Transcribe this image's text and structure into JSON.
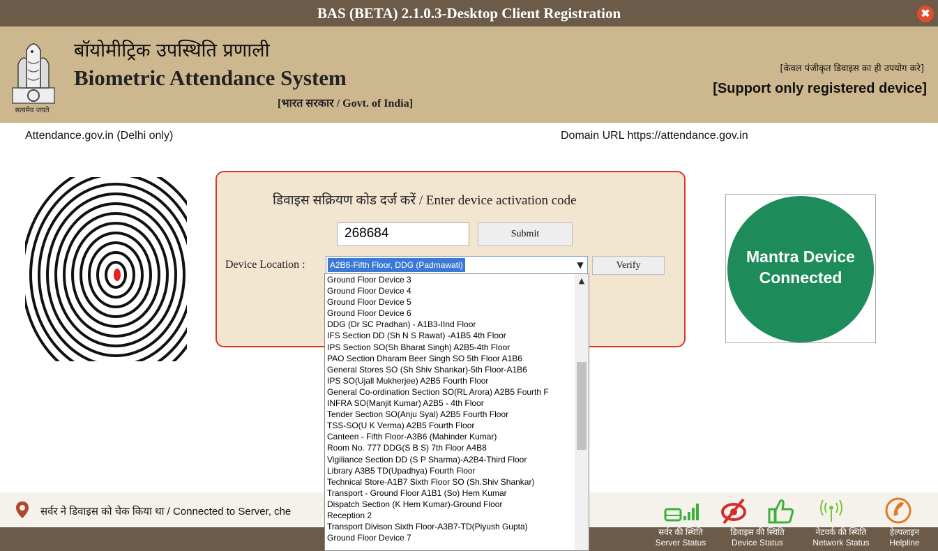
{
  "window": {
    "title": "BAS (BETA) 2.1.0.3-Desktop Client Registration",
    "close_glyph": "✖"
  },
  "header": {
    "emblem_caption": "सत्यमेव जयते",
    "hindi_title": "बॉयोमीट्रिक उपस्थिति प्रणाली",
    "english_title": "Biometric Attendance System",
    "govt_label": "[भारत सरकार / Govt. of India]",
    "support_hindi": "[केवल पंजीकृत डिवाइस का ही उपयोग करे]",
    "support_english": "[Support only registered device]"
  },
  "subheader": {
    "left": "Attendance.gov.in (Delhi only)",
    "right": "Domain URL https://attendance.gov.in"
  },
  "activation": {
    "title": "डिवाइस सक्रियण कोड दर्ज करें / Enter device activation code",
    "code_value": "268684",
    "submit_label": "Submit",
    "location_label": "Device Location :",
    "location_selected": "A2B6-Fifth Floor, DDG (Padmawati)",
    "verify_label": "Verify"
  },
  "device_status_badge": {
    "line1": "Mantra Device",
    "line2": "Connected",
    "color": "#1e8c5a"
  },
  "dropdown": {
    "options": [
      "Ground Floor Device 3",
      "Ground Floor Device 4",
      "Ground Floor Device 5",
      "Ground Floor Device 6",
      "DDG (Dr SC Pradhan) - A1B3-IInd Floor",
      "IFS Section DD (Sh N S Rawat) -A1B5 4th Floor",
      "IPS Section SO(Sh Bharat Singh) A2B5-4th Floor",
      "PAO Section Dharam Beer Singh SO 5th Floor A1B6",
      "General Stores SO (Sh Shiv Shankar)-5th Floor-A1B6",
      "IPS SO(Ujall Mukherjee) A2B5 Fourth Floor",
      "General Co-ordination Section SO(RL Arora) A2B5 Fourth F",
      "INFRA SO(Manjit Kumar) A2B5 - 4th Floor",
      "Tender Section SO(Anju Syal) A2B5 Fourth Floor",
      "TSS-SO(U K Verma) A2B5 Fourth Floor",
      "Canteen - Fifth Floor-A3B6 (Mahinder Kumar)",
      "Room No. 777 DDG(S B S) 7th Floor A4B8",
      "Vigiliance Section DD (S P Sharma)-A2B4-Third Floor",
      "Library A3B5 TD(Upadhya) Fourth Floor",
      "Technical Store-A1B7 Sixth Floor SO (Sh.Shiv Shankar)",
      "Transport - Ground Floor A1B1 (So) Hem Kumar",
      "Dispatch Section (K Hem Kumar)-Ground Floor",
      "Reception 2",
      "Transport Divison Sixth Floor-A3B7-TD(Piyush Gupta)",
      "Ground Floor Device 7"
    ]
  },
  "status": {
    "text": "सर्वर ने डिवाइस को चेक किया था / Connected to Server, che",
    "pin_icon": "location-pin-icon"
  },
  "footer_icons": [
    {
      "hindi": "सर्वर की स्थिति",
      "english": "Server Status",
      "icon": "server-signal-icon"
    },
    {
      "hindi": "डिवाइस की स्थिति",
      "english": "Device Status",
      "icon": "fingerprint-slash-icon"
    },
    {
      "hindi": "",
      "english": "",
      "icon": "thumbs-up-icon"
    },
    {
      "hindi": "नेटवर्क की स्थिति",
      "english": "Network Status",
      "icon": "wifi-tower-icon"
    },
    {
      "hindi": "हेल्पलाइन",
      "english": "Helpline",
      "icon": "phone-icon"
    }
  ],
  "colors": {
    "titlebar": "#6b5b48",
    "header": "#cdb78e",
    "panel_bg": "#f3e6d1",
    "panel_border": "#d63a2a",
    "selection": "#3a79d4",
    "device_green": "#1e8c5a",
    "icon_green": "#3bb03b",
    "icon_red": "#d42b2b"
  }
}
